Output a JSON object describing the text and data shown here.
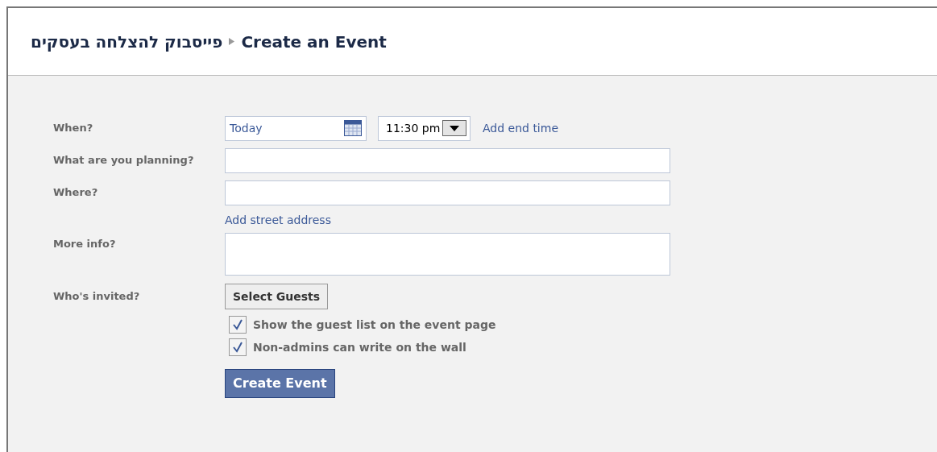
{
  "breadcrumb": {
    "parent": "פייסבוק להצלחה בעסקים",
    "current": "Create an Event"
  },
  "when": {
    "label": "When?",
    "date": "Today",
    "time": "11:30 pm",
    "link": "Add end time"
  },
  "planning": {
    "label": "What are you planning?"
  },
  "where": {
    "label": "Where?",
    "link": "Add street address"
  },
  "more_info": {
    "label": "More info?"
  },
  "invited": {
    "label": "Who's invited?",
    "button": "Select Guests"
  },
  "options": [
    {
      "label": "Show the guest list on the event page",
      "checked": true
    },
    {
      "label": "Non-admins can write on the wall",
      "checked": true
    }
  ],
  "submit": "Create Event"
}
